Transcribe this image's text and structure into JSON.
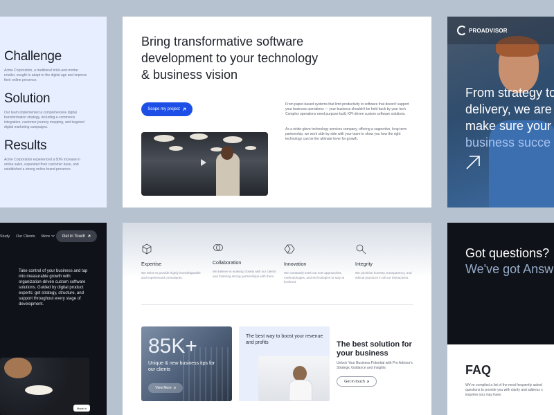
{
  "colors": {
    "accent_blue": "#1d4ee6",
    "dark_card": "#0f1218",
    "light_card": "#e6eeff",
    "backdrop": "#b6c2cf"
  },
  "left_top": {
    "challenge_title": "Challenge",
    "challenge_text": "Acme Corporation, a traditional brick-and-mortar retailer, sought to adapt to the digital age and improve their online presence.",
    "solution_title": "Solution",
    "solution_text": "Our team implemented a comprehensive digital transformation strategy, including e-commerce integration, customer journey mapping, and targeted digital marketing campaigns.",
    "results_title": "Results",
    "results_text": "Acme Corporation experienced a 50% increase in online sales, expanded their customer base, and established a strong online brand presence."
  },
  "center_top": {
    "headline": "Bring transformative software development to your technology & business vision",
    "cta_label": "Scope my project",
    "cta_icon": "arrow-up-right-icon",
    "para1": "From paper-based systems that limit productivity to software that doesn't support your business operations — your business shouldn't be held back by your tech. Complex operations need purpose-built, KPI-driven custom software solutions.",
    "para2": "As a white-glove technology services company, offering a supportive, long-term partnership, we work side-by-side with your team to show you how the right technology can be the ultimate lever for growth."
  },
  "right_top": {
    "logo_text": "PROADVISOR",
    "headline_line1": "From strategy to",
    "headline_line2": "delivery, we are h",
    "headline_line3": "make sure your",
    "headline_accent": "business succe"
  },
  "left_bottom": {
    "nav_items": [
      "Study",
      "Our Clients",
      "More"
    ],
    "nav_more_icon": "chevron-down-icon",
    "cta_label": "Get in Touch",
    "body": "Take control of your business and tap into measurable growth with organization-driven custom software solutions. Guided by digital product experts: get strategy, structure, and support throughout every stage of development.",
    "badge": "Made in"
  },
  "center_bottom": {
    "values": [
      {
        "title": "Expertise",
        "desc": "We strive to provide highly knowledgeable and experienced consultants.",
        "icon": "cube-icon"
      },
      {
        "title": "Collaboration",
        "desc": "We believe in working closely with our clients and fostering strong partnerships with them.",
        "icon": "circles-icon"
      },
      {
        "title": "Innovation",
        "desc": "We constantly seek out new approaches, methodologies, and technologies to stay at forefront.",
        "icon": "hexagon-icon"
      },
      {
        "title": "Integrity",
        "desc": "We prioritize honesty, transparency, and ethical practices in all our interactions.",
        "icon": "magnifier-icon"
      }
    ],
    "stat_number": "85K+",
    "stat_label": "Unique & new business tips for our clients",
    "stat_button": "View More",
    "promo_title": "The best way to boost your revenue and profits",
    "solution_title": "The best solution for your business",
    "solution_sub": "Unlock Your Business Potential with Pro Advisor's Strategic Guidance and Insights",
    "solution_button": "Get in touch"
  },
  "right_bottom": {
    "question": "Got questions?",
    "answer": "We've got Answ",
    "faq_title": "FAQ",
    "faq_sub": "We've compiled a list of the most frequently asked questions to provide you with clarity and address s inquiries you may have."
  }
}
